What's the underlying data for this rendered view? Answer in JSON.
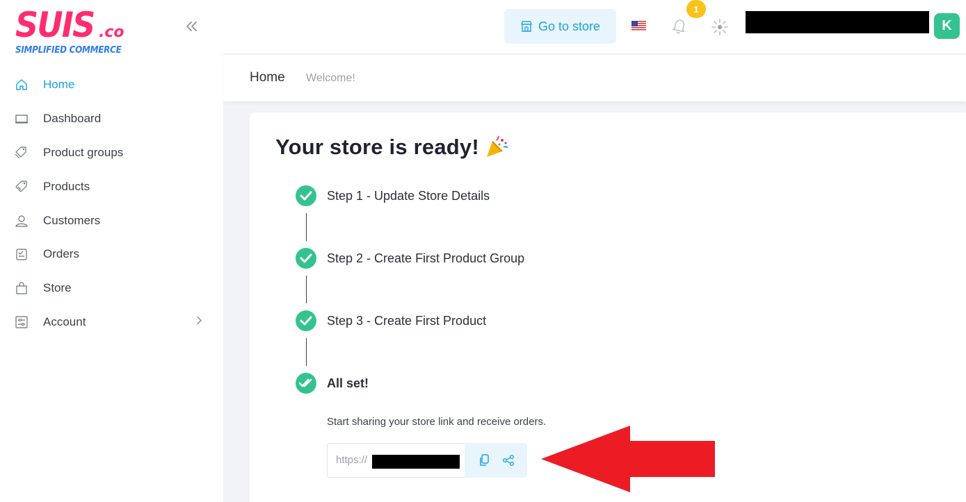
{
  "brand": {
    "logo_text": "SUIS",
    "logo_suffix": ".co",
    "logo_tagline": "SIMPLIFIED COMMERCE",
    "primary_color": "#ff2d6f",
    "accent_color": "#1aa3e0"
  },
  "sidebar": {
    "items": [
      {
        "label": "Home",
        "icon": "home-icon",
        "active": true
      },
      {
        "label": "Dashboard",
        "icon": "monitor-icon"
      },
      {
        "label": "Product groups",
        "icon": "tags-icon"
      },
      {
        "label": "Products",
        "icon": "tag-icon"
      },
      {
        "label": "Customers",
        "icon": "users-icon"
      },
      {
        "label": "Orders",
        "icon": "clipboard-icon"
      },
      {
        "label": "Store",
        "icon": "shopping-bag-icon"
      },
      {
        "label": "Account",
        "icon": "settings-sliders-icon",
        "has_submenu": true
      }
    ]
  },
  "topbar": {
    "go_to_store_label": "Go to store",
    "notification_count": "1",
    "avatar_initial": "K"
  },
  "breadcrumb": {
    "title": "Home",
    "subtitle": "Welcome!"
  },
  "main": {
    "title": "Your store is ready!",
    "steps": [
      {
        "label": "Step 1 - Update Store Details",
        "done": true
      },
      {
        "label": "Step 2 - Create First Product Group",
        "done": true
      },
      {
        "label": "Step 3 - Create First Product",
        "done": true
      },
      {
        "label": "All set!",
        "done": true
      }
    ],
    "share_text": "Start sharing your store link and receive orders.",
    "link_prefix": "https://"
  }
}
